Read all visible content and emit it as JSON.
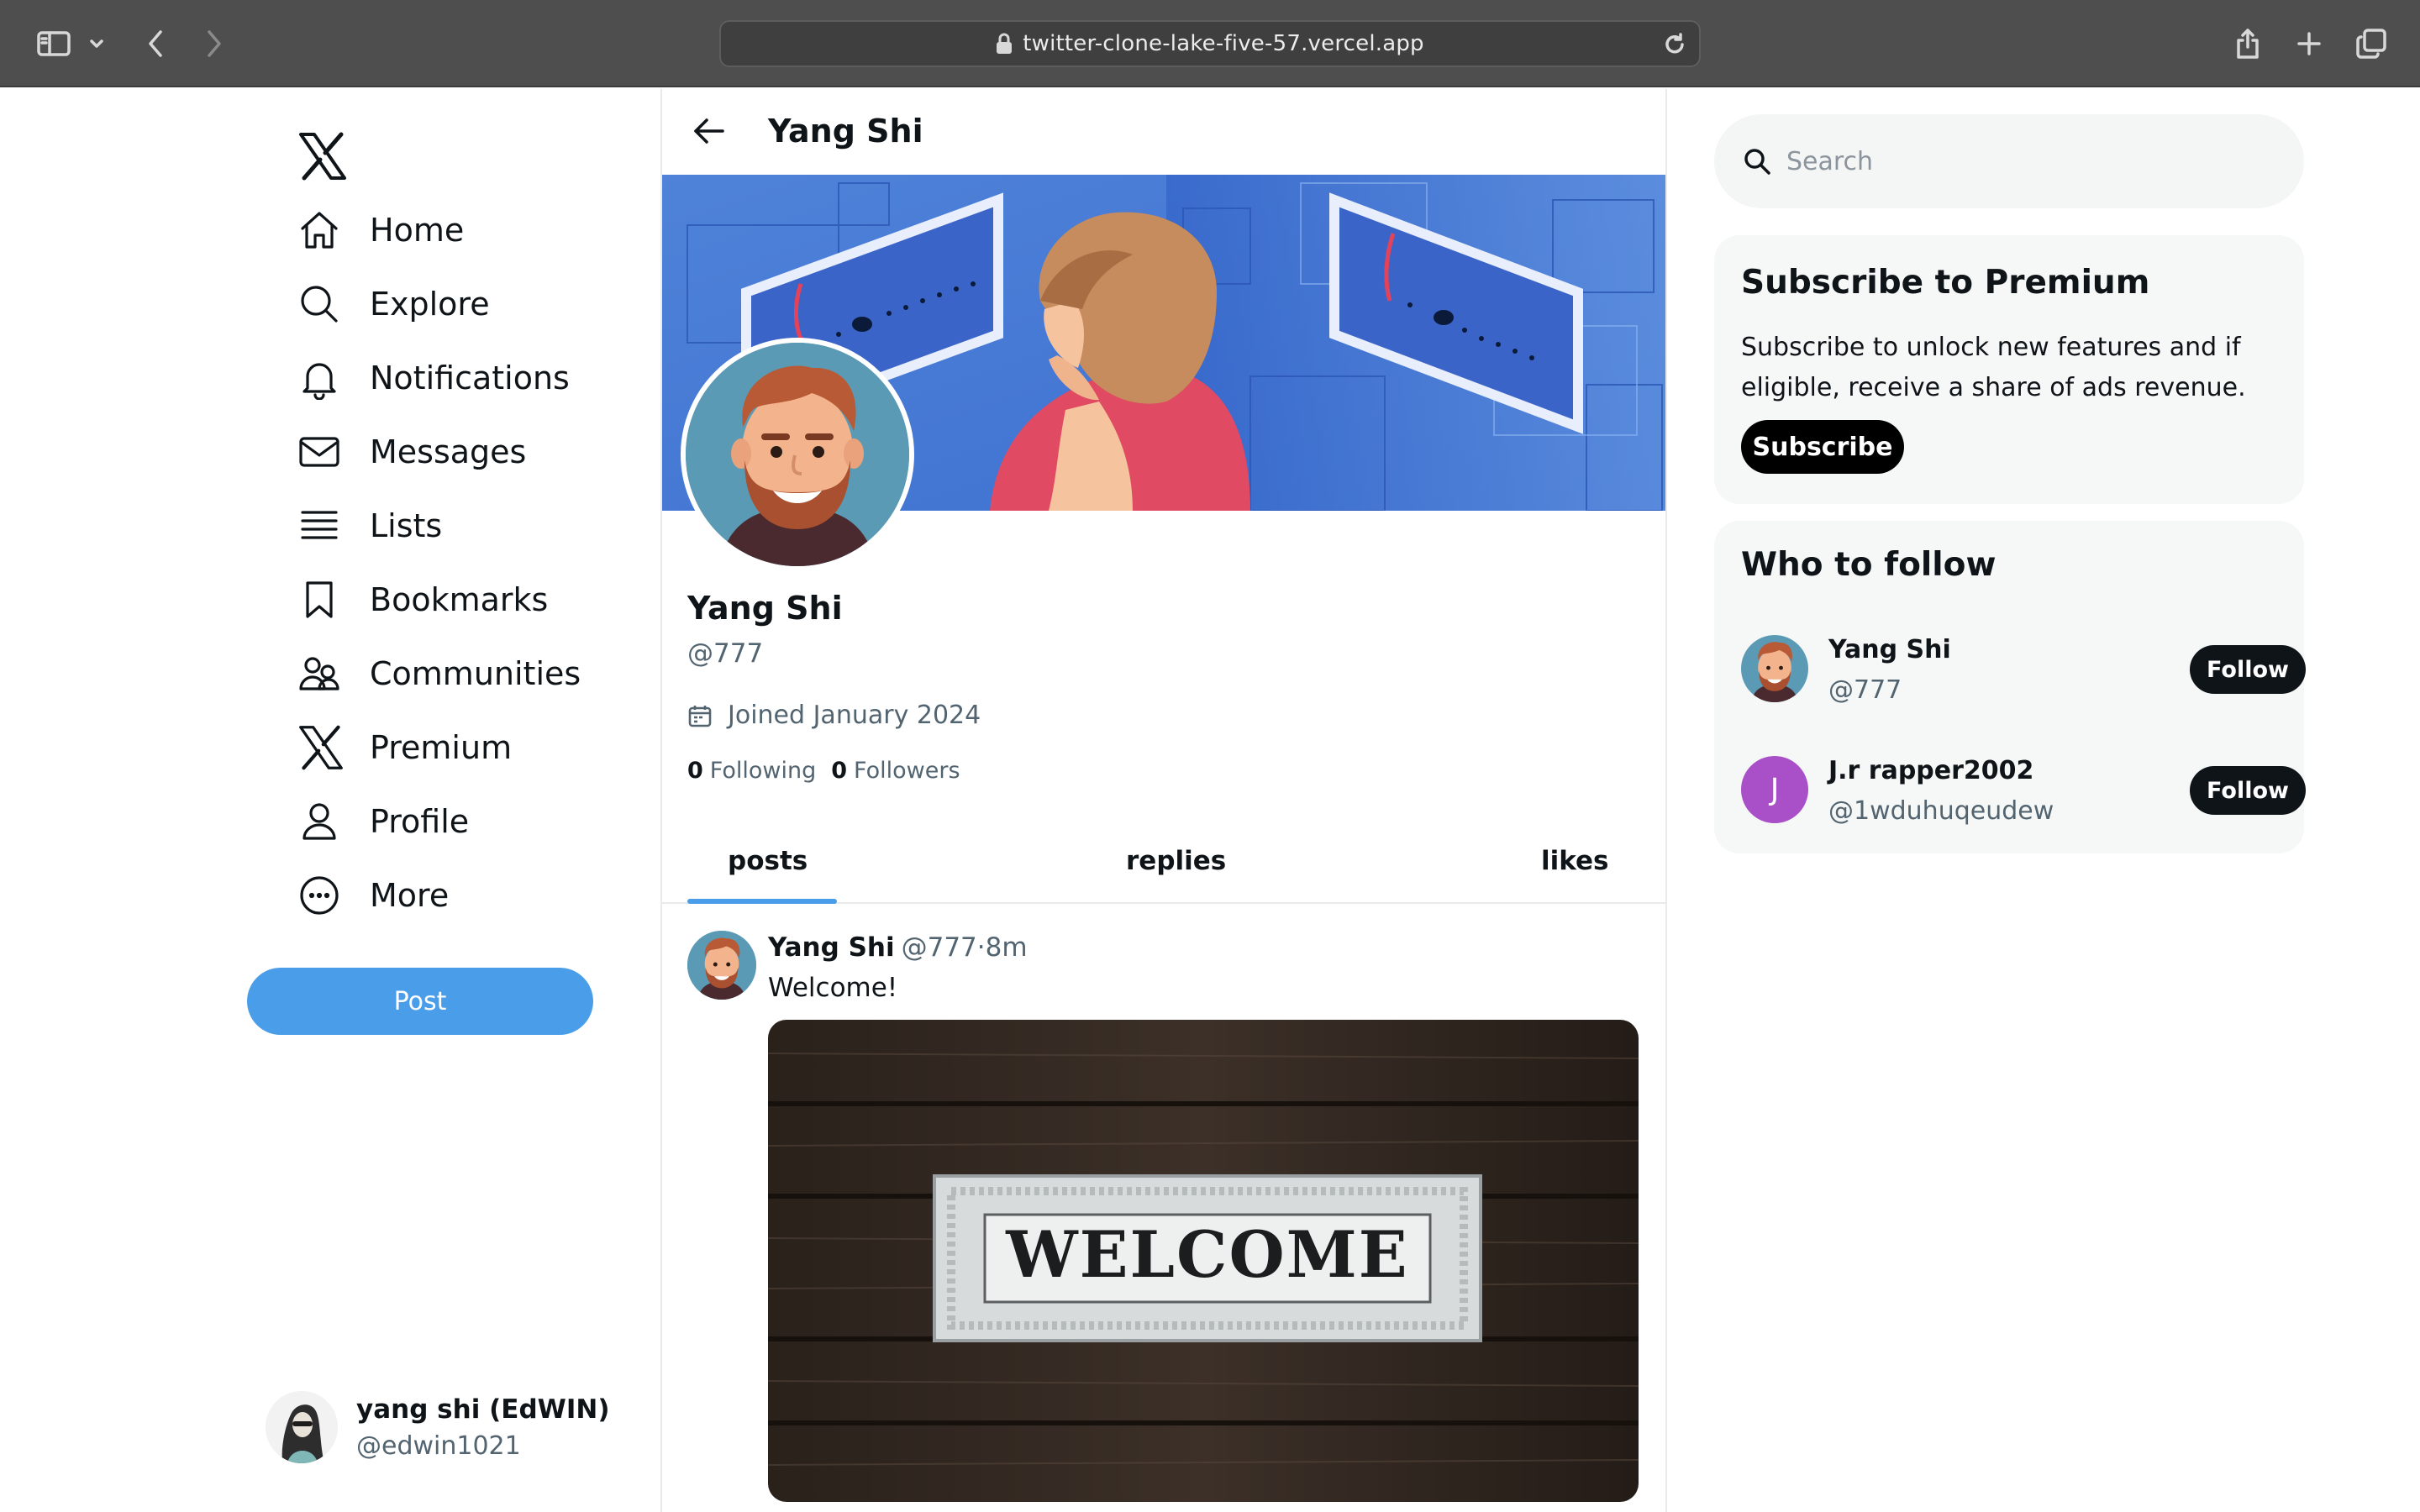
{
  "browser": {
    "url": "twitter-clone-lake-five-57.vercel.app"
  },
  "nav": {
    "logo_icon": "x-logo-icon",
    "items": [
      {
        "label": "Home",
        "icon": "home-icon"
      },
      {
        "label": "Explore",
        "icon": "search-icon"
      },
      {
        "label": "Notifications",
        "icon": "bell-icon"
      },
      {
        "label": "Messages",
        "icon": "mail-icon"
      },
      {
        "label": "Lists",
        "icon": "list-icon"
      },
      {
        "label": "Bookmarks",
        "icon": "bookmark-icon"
      },
      {
        "label": "Communities",
        "icon": "people-icon"
      },
      {
        "label": "Premium",
        "icon": "x-logo-icon"
      },
      {
        "label": "Profile",
        "icon": "person-icon"
      },
      {
        "label": "More",
        "icon": "more-circle-icon"
      }
    ],
    "post_label": "Post"
  },
  "current_user": {
    "name": "yang shi (EdWIN)",
    "handle": "@edwin1021"
  },
  "profile": {
    "header_title": "Yang Shi",
    "name": "Yang Shi",
    "handle": "@777",
    "joined": "Joined January 2024",
    "following_count": "0",
    "following_label": "Following",
    "followers_count": "0",
    "followers_label": "Followers",
    "tabs": [
      "posts",
      "replies",
      "likes"
    ],
    "active_tab": "posts"
  },
  "tweet": {
    "author_name": "Yang Shi",
    "author_handle": "@777",
    "time": "·8m",
    "text": "Welcome!",
    "image_sign_text": "WELCOME"
  },
  "search": {
    "placeholder": "Search"
  },
  "premium": {
    "title": "Subscribe to Premium",
    "description": "Subscribe to unlock new features and if eligible, receive a share of ads revenue.",
    "button": "Subscribe"
  },
  "who_to_follow": {
    "title": "Who to follow",
    "users": [
      {
        "name": "Yang Shi",
        "handle": "@777",
        "button": "Follow"
      },
      {
        "name": "J.r rapper2002",
        "handle": "@1wduhuqeudew",
        "initial": "J",
        "avatar_color": "#a94fc7",
        "button": "Follow"
      }
    ]
  },
  "colors": {
    "accent": "#4a9de9",
    "text": "#0f1419",
    "muted": "#536471"
  }
}
